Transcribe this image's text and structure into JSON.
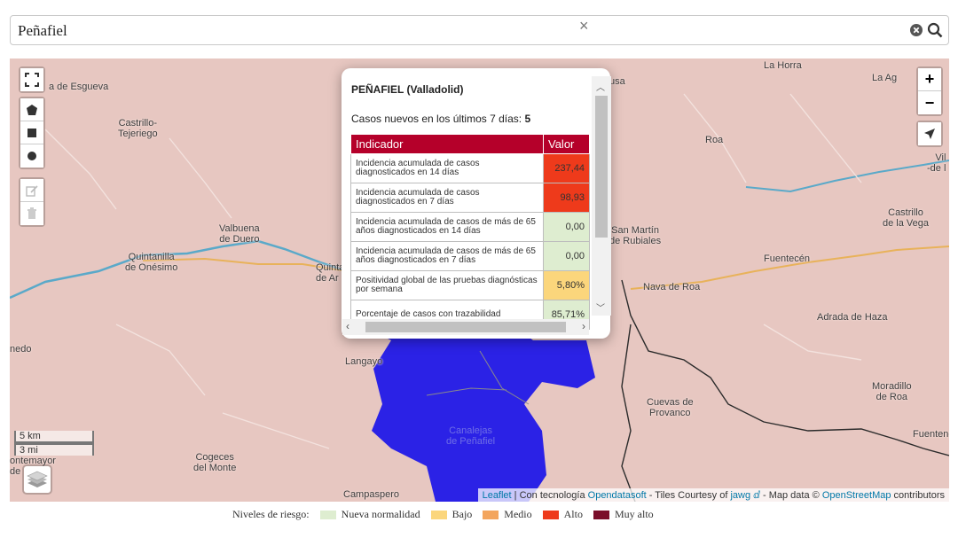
{
  "search": {
    "value": "Peñafiel"
  },
  "map": {
    "places": [
      {
        "id": "esgueva",
        "label": "a de Esgueva"
      },
      {
        "id": "castrillo-tejeriego",
        "label": "Castrillo-\nTejeriego"
      },
      {
        "id": "valbuena",
        "label": "Valbuena\nde Duero"
      },
      {
        "id": "quintanilla",
        "label": "Quintanilla\nde Onésimo"
      },
      {
        "id": "quinta",
        "label": "Quinta\nde Ar"
      },
      {
        "id": "langayo",
        "label": "Langayo"
      },
      {
        "id": "cogeces",
        "label": "Cogeces\ndel Monte"
      },
      {
        "id": "campaspero",
        "label": "Campaspero"
      },
      {
        "id": "nedo",
        "label": "nedo"
      },
      {
        "id": "ontemayor",
        "label": "ontemayor\nde"
      },
      {
        "id": "la-horra",
        "label": "La Horra"
      },
      {
        "id": "la-aguilera",
        "label": "La Ag"
      },
      {
        "id": "roa",
        "label": "Roa"
      },
      {
        "id": "villa",
        "label": "Vil\n-de l"
      },
      {
        "id": "castrillo-vega",
        "label": "Castrillo\nde la Vega"
      },
      {
        "id": "fuentecen",
        "label": "Fuentecén"
      },
      {
        "id": "nava-roa",
        "label": "Nava de Roa"
      },
      {
        "id": "san-martin",
        "label": "San Martín\nde Rubiales"
      },
      {
        "id": "adrada",
        "label": "Adrada de Haza"
      },
      {
        "id": "cuevas",
        "label": "Cuevas de\nProvanco"
      },
      {
        "id": "moradillo",
        "label": "Moradillo\nde Roa"
      },
      {
        "id": "fuentene",
        "label": "Fuentene"
      },
      {
        "id": "usa",
        "label": "usa"
      },
      {
        "id": "canalejas",
        "label": "Canalejas\nde Peñafiel"
      },
      {
        "id": "ui-n",
        "label": "n"
      }
    ],
    "scale": {
      "km": "5 km",
      "mi": "3 mi"
    },
    "attribution": {
      "leaflet": "Leaflet",
      "tech_prefix": " | Con tecnología ",
      "opendatasoft": "Opendatasoft",
      "tiles": " - Tiles Courtesy of ",
      "jawg": "jawg",
      "mapdata": " - Map data © ",
      "osm": "OpenStreetMap",
      "contrib": " contributors"
    }
  },
  "popup": {
    "title": "PEÑAFIEL (Valladolid)",
    "cases_label": "Casos nuevos en los últimos 7 días: ",
    "cases_value": "5",
    "headers": {
      "indicator": "Indicador",
      "value": "Valor"
    },
    "rows": [
      {
        "label": "Incidencia acumulada de casos diagnosticados en 14 días",
        "value": "237,44",
        "color": "#ee3a1b"
      },
      {
        "label": "Incidencia acumulada de casos diagnosticados en 7 días",
        "value": "98,93",
        "color": "#ee3a1b"
      },
      {
        "label": "Incidencia acumulada de casos de más de 65 años diagnosticados en 14 días",
        "value": "0,00",
        "color": "#deedd0"
      },
      {
        "label": "Incidencia acumulada de casos de más de 65 años diagnosticados en 7 días",
        "value": "0,00",
        "color": "#deedd0"
      },
      {
        "label": "Positividad global de las pruebas diagnósticas por semana",
        "value": "5,80%",
        "color": "#fbd67c"
      },
      {
        "label": "Porcentaje de casos con trazabilidad",
        "value": "85,71%",
        "color": "#deedd0"
      }
    ]
  },
  "legend": {
    "title": "Niveles de riesgo:",
    "items": [
      {
        "label": "Nueva normalidad",
        "color": "#deedd0"
      },
      {
        "label": "Bajo",
        "color": "#fbd67c"
      },
      {
        "label": "Medio",
        "color": "#f3a55e"
      },
      {
        "label": "Alto",
        "color": "#ee3a1b"
      },
      {
        "label": "Muy alto",
        "color": "#7a0e2a"
      }
    ]
  },
  "colors": {
    "region": "#2b22e6",
    "popup_header": "#b5002a",
    "river": "#5aa9c9",
    "road": "#e8b25a"
  }
}
